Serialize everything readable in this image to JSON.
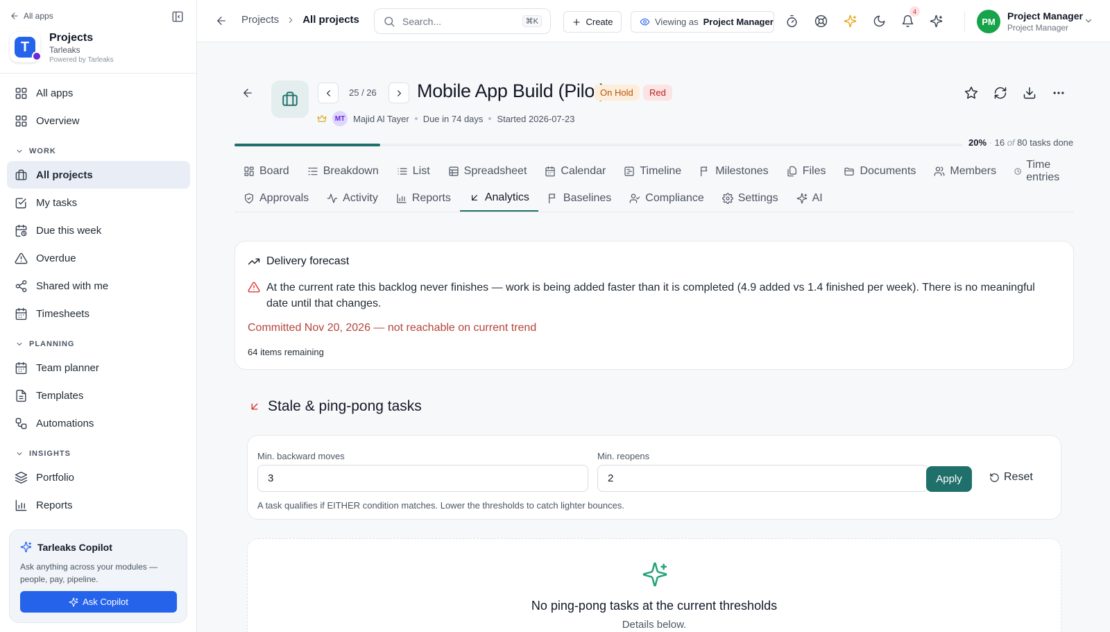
{
  "sidebar": {
    "all_apps_link": "All apps",
    "app_name": "Projects",
    "app_org": "Tarleaks",
    "app_powered": "Powered by Tarleaks",
    "logo_letter": "T",
    "items_top": [
      {
        "label": "All apps",
        "icon": "grid-icon"
      },
      {
        "label": "Overview",
        "icon": "grid-icon"
      }
    ],
    "section_work": "WORK",
    "items_work": [
      {
        "label": "All projects",
        "icon": "briefcase-icon",
        "active": true
      },
      {
        "label": "My tasks",
        "icon": "checkbox-icon"
      },
      {
        "label": "Due this week",
        "icon": "calendar-clock-icon"
      },
      {
        "label": "Overdue",
        "icon": "alert-triangle-icon"
      },
      {
        "label": "Shared with me",
        "icon": "share-icon"
      },
      {
        "label": "Timesheets",
        "icon": "calendar-icon"
      }
    ],
    "section_planning": "PLANNING",
    "items_planning": [
      {
        "label": "Team planner",
        "icon": "calendar-icon"
      },
      {
        "label": "Templates",
        "icon": "file-icon"
      },
      {
        "label": "Automations",
        "icon": "workflow-icon"
      }
    ],
    "section_insights": "INSIGHTS",
    "items_insights": [
      {
        "label": "Portfolio",
        "icon": "layers-icon"
      },
      {
        "label": "Reports",
        "icon": "bar-chart-icon"
      }
    ],
    "copilot": {
      "title": "Tarleaks Copilot",
      "description": "Ask anything across your modules — people, pay, pipeline.",
      "button": "Ask Copilot"
    }
  },
  "topbar": {
    "breadcrumb_parent": "Projects",
    "breadcrumb_current": "All projects",
    "search_placeholder": "Search...",
    "search_shortcut": "⌘K",
    "create_label": "Create",
    "viewing_prefix": "Viewing as",
    "viewing_role": "Project Manager",
    "notification_count": "4",
    "user_initials": "PM",
    "user_name": "Project Manager",
    "user_role": "Project Manager"
  },
  "project": {
    "pager": "25 / 26",
    "title": "Mobile App Build (Pilot)",
    "status_badge": "On Hold",
    "health_badge": "Red",
    "owner_initials": "MT",
    "owner_name": "Majid Al Tayer",
    "due": "Due in 74 days",
    "started": "Started 2026-07-23",
    "progress_fraction": 0.2,
    "progress_percent": "20%",
    "tasks_done": "16",
    "tasks_of": "of",
    "tasks_total": "80",
    "tasks_suffix": "tasks done"
  },
  "tabs_row1": [
    {
      "label": "Board",
      "icon": "board-icon"
    },
    {
      "label": "Breakdown",
      "icon": "breakdown-icon"
    },
    {
      "label": "List",
      "icon": "list-icon"
    },
    {
      "label": "Spreadsheet",
      "icon": "table-icon"
    },
    {
      "label": "Calendar",
      "icon": "calendar-icon"
    },
    {
      "label": "Timeline",
      "icon": "timeline-icon"
    },
    {
      "label": "Milestones",
      "icon": "flag-icon"
    },
    {
      "label": "Files",
      "icon": "files-icon"
    },
    {
      "label": "Documents",
      "icon": "folder-icon"
    },
    {
      "label": "Members",
      "icon": "users-icon"
    },
    {
      "label": "Time entries",
      "icon": "clock-icon"
    }
  ],
  "tabs_row2": [
    {
      "label": "Approvals",
      "icon": "shield-check-icon"
    },
    {
      "label": "Activity",
      "icon": "activity-icon"
    },
    {
      "label": "Reports",
      "icon": "bar-chart-icon"
    },
    {
      "label": "Analytics",
      "icon": "arrow-down-left-icon",
      "active": true
    },
    {
      "label": "Baselines",
      "icon": "flag-icon"
    },
    {
      "label": "Compliance",
      "icon": "user-check-icon"
    },
    {
      "label": "Settings",
      "icon": "gear-icon"
    },
    {
      "label": "AI",
      "icon": "sparkles-icon"
    }
  ],
  "forecast": {
    "title": "Delivery forecast",
    "warning": "At the current rate this backlog never finishes — work is being added faster than it is completed (4.9 added vs 1.4 finished per week). There is no meaningful date until that changes.",
    "committed": "Committed Nov 20, 2026 — not reachable on current trend",
    "remaining": "64 items remaining"
  },
  "stale": {
    "title": "Stale & ping-pong tasks",
    "min_backward_label": "Min. backward moves",
    "min_backward_value": "3",
    "min_reopens_label": "Min. reopens",
    "min_reopens_value": "2",
    "apply_label": "Apply",
    "reset_label": "Reset",
    "hint": "A task qualifies if EITHER condition matches. Lower the thresholds to catch lighter bounces.",
    "empty_title": "No ping-pong tasks at the current thresholds",
    "empty_subtitle": "Details below."
  },
  "colors": {
    "accent": "#1f6f6b",
    "brand_blue": "#2563eb",
    "danger": "#dc2626"
  }
}
